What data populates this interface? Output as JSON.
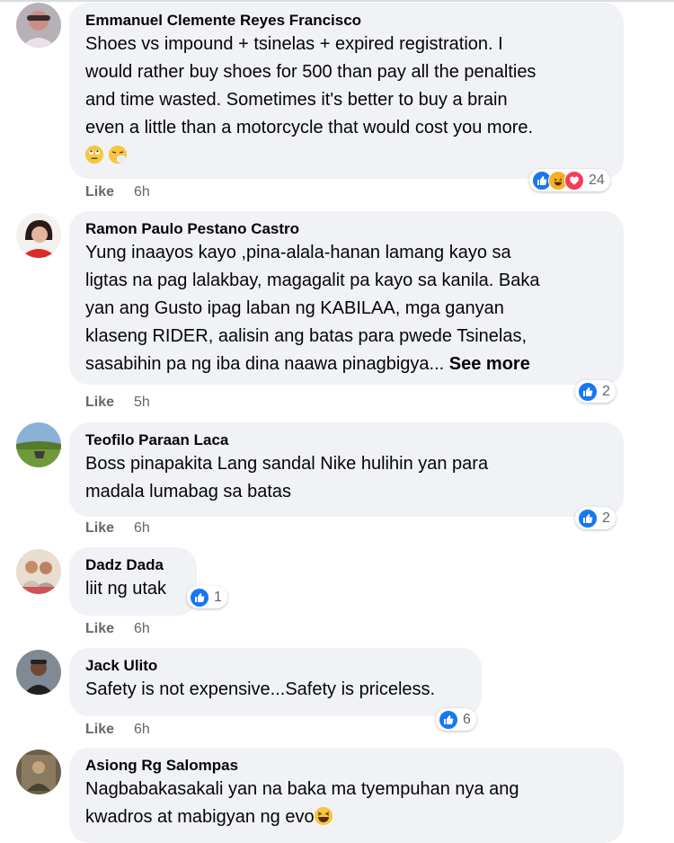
{
  "comments": [
    {
      "author": "Emmanuel Clemente Reyes Francisco",
      "lines": [
        "Shoes vs impound + tsinelas + expired registration. I",
        "would rather buy shoes for 500 than pay all the penalties",
        "and time wasted. Sometimes it's better to buy a brain",
        "even a little than a motorcycle that would cost you more."
      ],
      "emojis": [
        "rolling-eyes-emoji",
        "sneezing-face-emoji"
      ],
      "like_label": "Like",
      "time": "6h",
      "reactions": [
        "like-reaction-icon",
        "haha-reaction-icon",
        "love-reaction-icon"
      ],
      "reaction_count": "24"
    },
    {
      "author": "Ramon Paulo Pestano Castro",
      "lines": [
        "Yung inaayos kayo ,pina-alala-hanan lamang kayo sa",
        "ligtas na pag lalakbay, magagalit pa kayo sa kanila. Baka",
        "yan ang Gusto ipag laban ng KABILAA, mga ganyan",
        "klaseng RIDER, aalisin ang batas para pwede Tsinelas,",
        "sasabihin pa ng iba dina naawa pinagbigya..."
      ],
      "see_more": "See more",
      "like_label": "Like",
      "time": "5h",
      "reactions": [
        "like-reaction-icon"
      ],
      "reaction_count": "2"
    },
    {
      "author": "Teofilo Paraan Laca",
      "lines": [
        "Boss pinapakita Lang sandal Nike hulihin yan para",
        "madala lumabag sa batas"
      ],
      "like_label": "Like",
      "time": "6h",
      "reactions": [
        "like-reaction-icon"
      ],
      "reaction_count": "2"
    },
    {
      "author": "Dadz Dada",
      "lines": [
        "liit ng utak"
      ],
      "like_label": "Like",
      "time": "6h",
      "reactions": [
        "like-reaction-icon"
      ],
      "reaction_count": "1"
    },
    {
      "author": "Jack Ulito",
      "lines": [
        "Safety is not expensive...Safety is priceless."
      ],
      "like_label": "Like",
      "time": "6h",
      "reactions": [
        "like-reaction-icon"
      ],
      "reaction_count": "6"
    },
    {
      "author": "Asiong Rg Salompas",
      "lines": [
        "Nagbabakasakali yan na baka ma tyempuhan nya ang",
        "kwadros at mabigyan ng evo"
      ],
      "emojis": [
        "laughing-face-emoji"
      ]
    }
  ],
  "colors": {
    "bubble": "#f0f2f5",
    "meta_text": "#65676b",
    "like_blue": "#1877f2",
    "haha_yellow": "#f7b125",
    "love_red": "#f33e58"
  }
}
